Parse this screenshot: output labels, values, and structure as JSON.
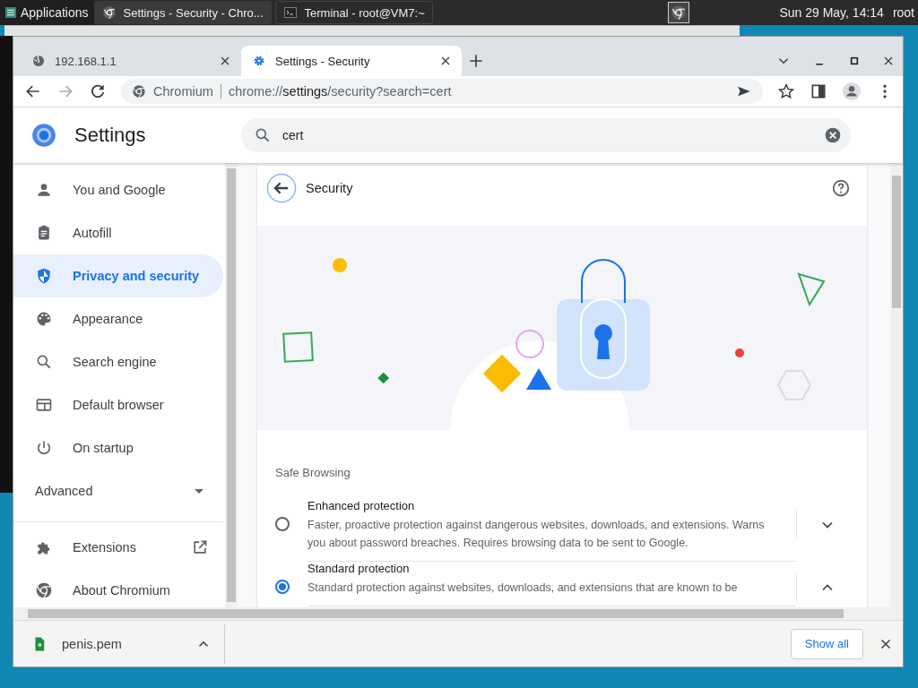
{
  "taskbar": {
    "apps_menu": "Applications",
    "windows": [
      {
        "title": "Settings - Security - Chro...",
        "selected": true
      },
      {
        "title": "Terminal - root@VM7:~",
        "selected": false
      }
    ],
    "clock": "Sun 29 May, 14:14",
    "user": "root"
  },
  "tabs": [
    {
      "title": "192.168.1.1",
      "selected": false
    },
    {
      "title": "Settings - Security",
      "selected": true
    }
  ],
  "omnibox": {
    "site_label": "Chromium",
    "url": "chrome://**settings**/security?search=cert"
  },
  "settings_header": {
    "title": "Settings",
    "search": {
      "value": "cert"
    }
  },
  "sidebar": {
    "items": [
      {
        "label": "You and Google",
        "selected": false
      },
      {
        "label": "Autofill",
        "selected": false
      },
      {
        "label": "Privacy and security",
        "selected": true
      },
      {
        "label": "Appearance",
        "selected": false
      },
      {
        "label": "Search engine",
        "selected": false
      },
      {
        "label": "Default browser",
        "selected": false
      },
      {
        "label": "On startup",
        "selected": false
      }
    ],
    "advanced": {
      "label": "Advanced",
      "expanded": false
    },
    "footer_items": [
      {
        "label": "Extensions",
        "external": true
      },
      {
        "label": "About Chromium",
        "external": false
      }
    ]
  },
  "page": {
    "title": "Security",
    "section": "Safe Browsing",
    "options": [
      {
        "title": "Enhanced protection",
        "description": "Faster, proactive protection against dangerous websites, downloads, and extensions. Warns you about password breaches. Requires browsing data to be sent to Google.",
        "selected": false,
        "expanded": false
      },
      {
        "title": "Standard protection",
        "description": "Standard protection against websites, downloads, and extensions that are known to be",
        "selected": true,
        "expanded": true
      }
    ]
  },
  "download_bar": {
    "items": [
      {
        "filename": "penis.pem"
      }
    ],
    "show_all": "Show all"
  }
}
